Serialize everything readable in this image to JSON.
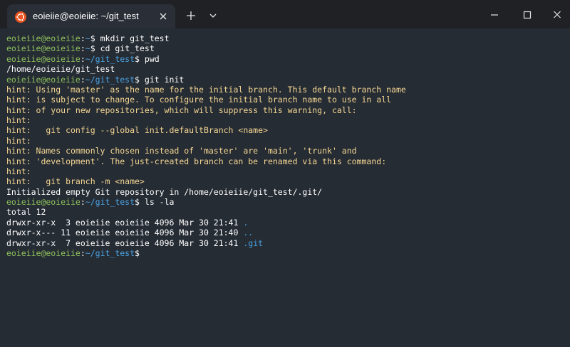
{
  "window": {
    "tab_title": "eoieiie@eoieiie: ~/git_test",
    "icons": {
      "app": "ubuntu-icon",
      "tab_close": "close-icon",
      "new_tab": "plus-icon",
      "tab_dropdown": "chevron-down-icon",
      "minimize": "minimize-icon",
      "maximize": "maximize-icon",
      "close": "close-icon"
    }
  },
  "colors": {
    "background": "#262c34",
    "titlebar": "#202125",
    "prompt_user": "#8ec05c",
    "prompt_path": "#4ba3e4",
    "hint_text": "#f5d793",
    "output_text": "#ffffff"
  },
  "terminal": {
    "lines": [
      {
        "type": "prompt",
        "user": "eoieiie@eoieiie",
        "sep": ":",
        "path": "~",
        "dollar": "$ ",
        "command": "mkdir git_test"
      },
      {
        "type": "prompt",
        "user": "eoieiie@eoieiie",
        "sep": ":",
        "path": "~",
        "dollar": "$ ",
        "command": "cd git_test"
      },
      {
        "type": "prompt",
        "user": "eoieiie@eoieiie",
        "sep": ":",
        "path": "~/git_test",
        "dollar": "$ ",
        "command": "pwd"
      },
      {
        "type": "output",
        "text": "/home/eoieiie/git_test"
      },
      {
        "type": "prompt",
        "user": "eoieiie@eoieiie",
        "sep": ":",
        "path": "~/git_test",
        "dollar": "$ ",
        "command": "git init"
      },
      {
        "type": "hint",
        "text": "hint: Using 'master' as the name for the initial branch. This default branch name"
      },
      {
        "type": "hint",
        "text": "hint: is subject to change. To configure the initial branch name to use in all"
      },
      {
        "type": "hint",
        "text": "hint: of your new repositories, which will suppress this warning, call:"
      },
      {
        "type": "hint",
        "text": "hint:"
      },
      {
        "type": "hint",
        "text": "hint:   git config --global init.defaultBranch <name>"
      },
      {
        "type": "hint",
        "text": "hint:"
      },
      {
        "type": "hint",
        "text": "hint: Names commonly chosen instead of 'master' are 'main', 'trunk' and"
      },
      {
        "type": "hint",
        "text": "hint: 'development'. The just-created branch can be renamed via this command:"
      },
      {
        "type": "hint",
        "text": "hint:"
      },
      {
        "type": "hint",
        "text": "hint:   git branch -m <name>"
      },
      {
        "type": "output",
        "text": "Initialized empty Git repository in /home/eoieiie/git_test/.git/"
      },
      {
        "type": "prompt",
        "user": "eoieiie@eoieiie",
        "sep": ":",
        "path": "~/git_test",
        "dollar": "$ ",
        "command": "ls -la"
      },
      {
        "type": "output",
        "text": "total 12"
      },
      {
        "type": "listing",
        "text": "drwxr-xr-x  3 eoieiie eoieiie 4096 Mar 30 21:41 ",
        "name": "."
      },
      {
        "type": "listing",
        "text": "drwxr-x--- 11 eoieiie eoieiie 4096 Mar 30 21:40 ",
        "name": ".."
      },
      {
        "type": "listing",
        "text": "drwxr-xr-x  7 eoieiie eoieiie 4096 Mar 30 21:41 ",
        "name": ".git"
      },
      {
        "type": "prompt",
        "user": "eoieiie@eoieiie",
        "sep": ":",
        "path": "~/git_test",
        "dollar": "$",
        "command": ""
      }
    ]
  }
}
